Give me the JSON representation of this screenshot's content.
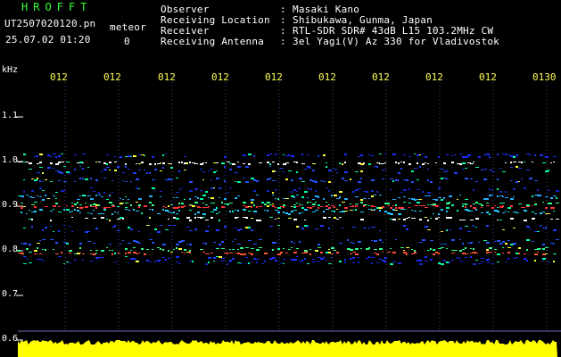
{
  "app_title": "HROFFT",
  "file_name": "UT2507020120.pn",
  "meteor_label": "meteor",
  "datetime": "25.07.02 01:20",
  "count": "0",
  "info": [
    {
      "label": "Observer",
      "value": "Masaki Kano"
    },
    {
      "label": "Receiving Location",
      "value": "Shibukawa, Gunma, Japan"
    },
    {
      "label": "Receiver",
      "value": "RTL-SDR SDR# 43dB L15 103.2MHz CW"
    },
    {
      "label": "Receiving Antenna",
      "value": "3el Yagi(V) Az 330 for Vladivostok"
    }
  ],
  "separator": ":",
  "x_ticks": [
    "012",
    "012",
    "012",
    "012",
    "012",
    "012",
    "012",
    "012",
    "012",
    "0130"
  ],
  "y_unit": "kHz",
  "y_ticks": [
    "1.1",
    "1.0",
    "0.9",
    "0.8",
    "0.7",
    "0.6"
  ],
  "colors": {
    "background": "#000000",
    "title": "#33ff33",
    "ticks": "#ffff55",
    "amplitude": "#ffff00"
  }
}
